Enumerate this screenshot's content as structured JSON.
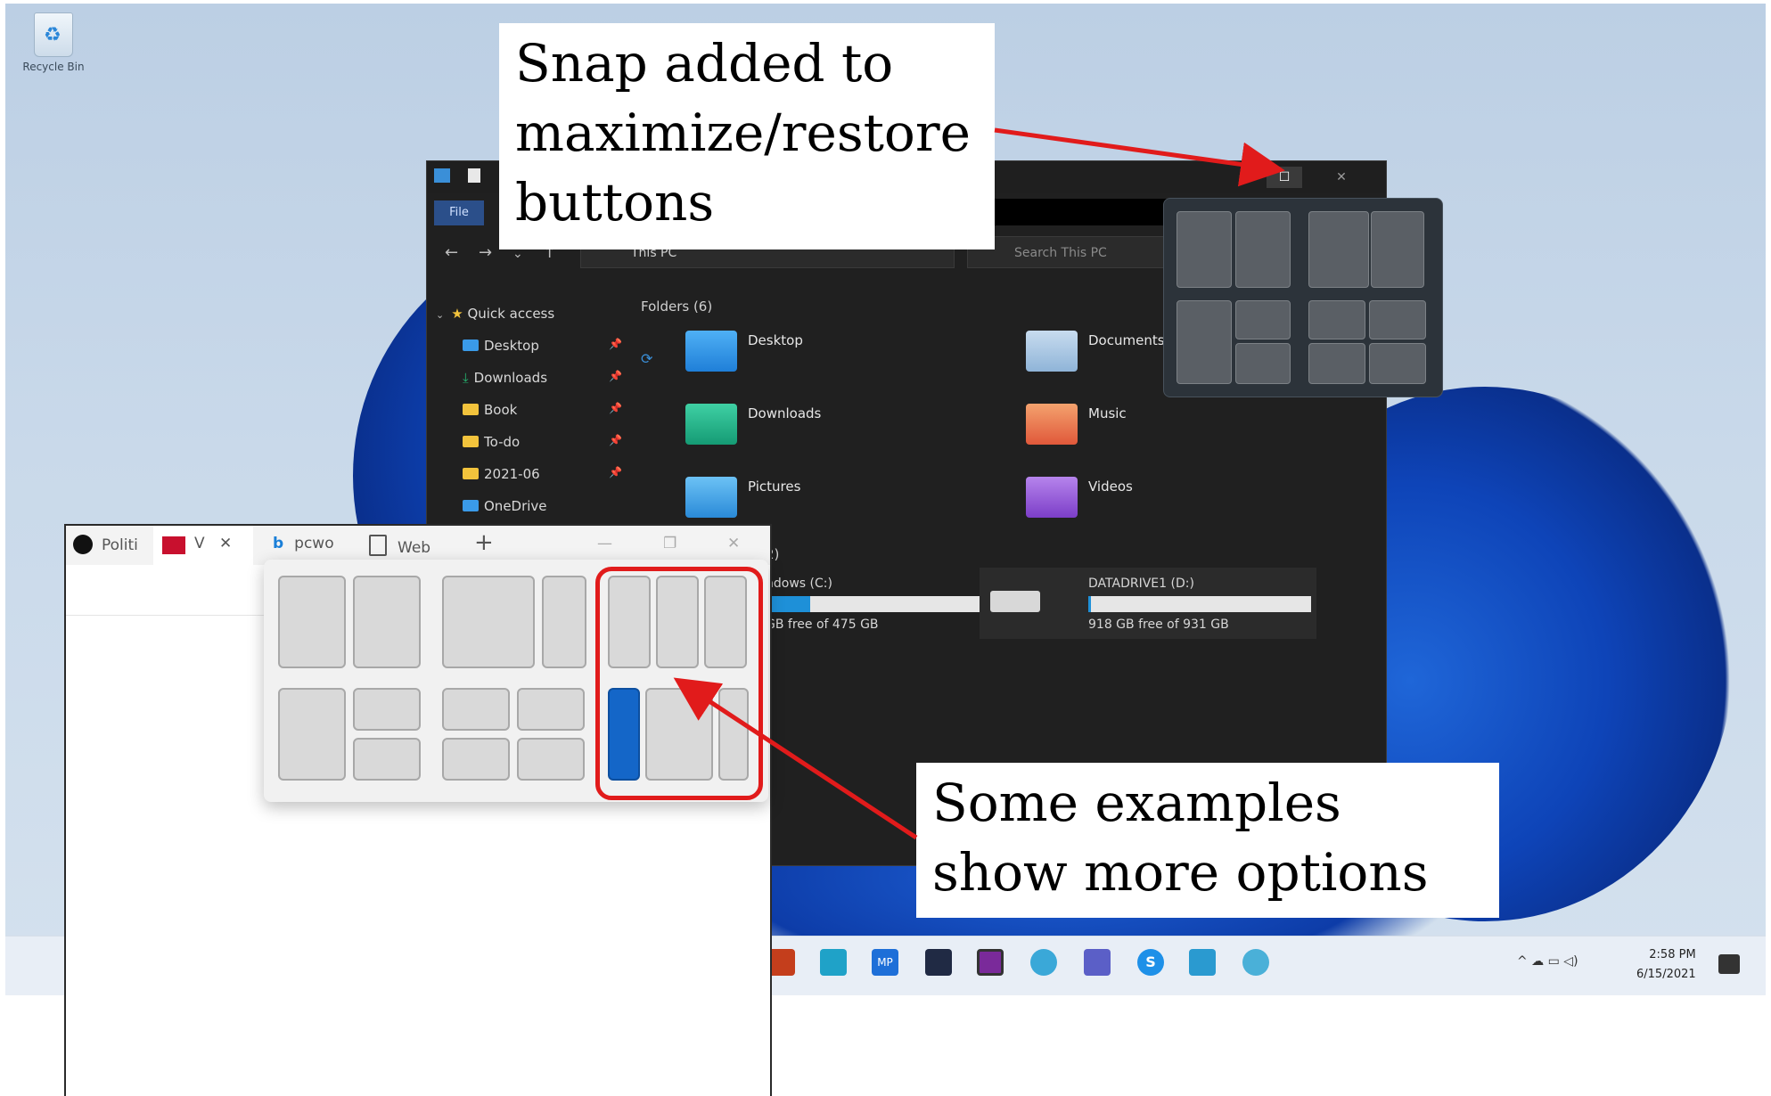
{
  "desktop": {
    "recycle_bin_label": "Recycle Bin"
  },
  "explorer": {
    "file_tab": "File",
    "address": "This PC",
    "search_placeholder": "Search This PC",
    "window_buttons": {
      "minimize": "—",
      "maximize": "☐",
      "close": "✕"
    },
    "sidebar": [
      {
        "label": "Quick access",
        "icon": "star-icon"
      },
      {
        "label": "Desktop",
        "icon": "desktop-icon",
        "pinned": true
      },
      {
        "label": "Downloads",
        "icon": "download-icon",
        "pinned": true
      },
      {
        "label": "Book",
        "icon": "folder-icon",
        "pinned": true
      },
      {
        "label": "To-do",
        "icon": "folder-icon",
        "pinned": true
      },
      {
        "label": "2021-06",
        "icon": "folder-icon",
        "pinned": true
      },
      {
        "label": "OneDrive",
        "icon": "cloud-icon",
        "pinned": false
      }
    ],
    "folders_header": "Folders (6)",
    "folders": [
      {
        "label": "Desktop",
        "color": "#2f8fe0"
      },
      {
        "label": "Documents",
        "color": "#8fb4d8"
      },
      {
        "label": "Downloads",
        "color": "#1fb38a"
      },
      {
        "label": "Music",
        "color": "#e8744a"
      },
      {
        "label": "Pictures",
        "color": "#3aa0e8"
      },
      {
        "label": "Videos",
        "color": "#9a5ad8"
      }
    ],
    "drives_header": "2)",
    "drives": [
      {
        "label": "ndows (C:)",
        "free": "GB free of 475 GB",
        "used_fraction": 0.2
      },
      {
        "label": "DATADRIVE1 (D:)",
        "free": "918 GB free of 931 GB",
        "used_fraction": 0.01
      }
    ]
  },
  "browser": {
    "tabs": [
      {
        "label": "Politi",
        "icon": "abc-icon"
      },
      {
        "label": "V",
        "icon": "pcw-icon",
        "close": "✕"
      },
      {
        "label": "pcwo",
        "icon": "bing-icon"
      },
      {
        "label": "Web",
        "icon": "page-icon"
      }
    ],
    "new_tab": "+",
    "window_buttons": {
      "minimize": "—",
      "restore": "❐",
      "close": "✕"
    }
  },
  "taskbar": {
    "apps": [
      "office-icon",
      "notepad-icon",
      "mp-icon",
      "media-icon",
      "photo-icon",
      "edge-icon",
      "teams-icon",
      "skype-icon",
      "app-icon",
      "network-icon"
    ],
    "tray": "^ ☁ ▭ ◁)",
    "time": "2:58 PM",
    "date": "6/15/2021"
  },
  "callouts": {
    "top": "Snap added to maximize/restore buttons",
    "bottom": "Some examples show more options",
    "color": "#e11b1b"
  }
}
